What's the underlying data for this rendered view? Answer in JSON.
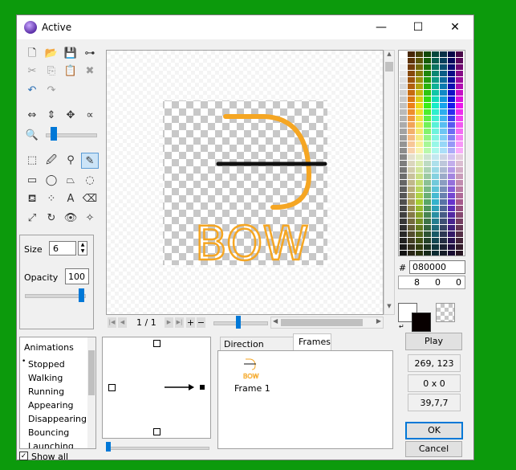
{
  "window": {
    "title": "Active",
    "minimize": "—",
    "maximize": "☐",
    "close": "✕"
  },
  "size": {
    "label": "Size",
    "value": "6"
  },
  "opacity": {
    "label": "Opacity",
    "value": "100"
  },
  "frames_nav": {
    "counter": "1 / 1"
  },
  "color": {
    "hash": "#",
    "hex": "080000",
    "r": "8",
    "g": "0",
    "b": "0",
    "selected": "#080000"
  },
  "animations": {
    "header": "Animations",
    "items": [
      {
        "label": "Stopped",
        "selected": true
      },
      {
        "label": "Walking"
      },
      {
        "label": "Running"
      },
      {
        "label": "Appearing"
      },
      {
        "label": "Disappearing"
      },
      {
        "label": "Bouncing"
      },
      {
        "label": "Launching"
      }
    ]
  },
  "show_all": {
    "label": "Show all",
    "checked": true
  },
  "tabs": {
    "direction": "Direction Options",
    "frames": "Frames"
  },
  "frame": {
    "label": "Frame 1",
    "thumb_text": "BOW"
  },
  "image": {
    "text": "BOW",
    "stroke_color": "#f5a623"
  },
  "buttons": {
    "play": "Play",
    "ok": "OK",
    "cancel": "Cancel"
  },
  "readouts": {
    "coords": "269, 123",
    "size": "0 x 0",
    "values": "39,7,7"
  }
}
